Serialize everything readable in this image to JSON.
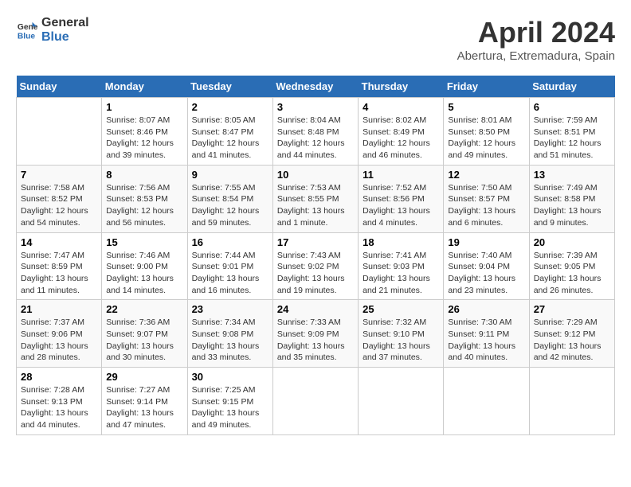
{
  "header": {
    "logo_general": "General",
    "logo_blue": "Blue",
    "month_title": "April 2024",
    "location": "Abertura, Extremadura, Spain"
  },
  "days_of_week": [
    "Sunday",
    "Monday",
    "Tuesday",
    "Wednesday",
    "Thursday",
    "Friday",
    "Saturday"
  ],
  "weeks": [
    [
      {
        "day": "",
        "sunrise": "",
        "sunset": "",
        "daylight": ""
      },
      {
        "day": "1",
        "sunrise": "Sunrise: 8:07 AM",
        "sunset": "Sunset: 8:46 PM",
        "daylight": "Daylight: 12 hours and 39 minutes."
      },
      {
        "day": "2",
        "sunrise": "Sunrise: 8:05 AM",
        "sunset": "Sunset: 8:47 PM",
        "daylight": "Daylight: 12 hours and 41 minutes."
      },
      {
        "day": "3",
        "sunrise": "Sunrise: 8:04 AM",
        "sunset": "Sunset: 8:48 PM",
        "daylight": "Daylight: 12 hours and 44 minutes."
      },
      {
        "day": "4",
        "sunrise": "Sunrise: 8:02 AM",
        "sunset": "Sunset: 8:49 PM",
        "daylight": "Daylight: 12 hours and 46 minutes."
      },
      {
        "day": "5",
        "sunrise": "Sunrise: 8:01 AM",
        "sunset": "Sunset: 8:50 PM",
        "daylight": "Daylight: 12 hours and 49 minutes."
      },
      {
        "day": "6",
        "sunrise": "Sunrise: 7:59 AM",
        "sunset": "Sunset: 8:51 PM",
        "daylight": "Daylight: 12 hours and 51 minutes."
      }
    ],
    [
      {
        "day": "7",
        "sunrise": "Sunrise: 7:58 AM",
        "sunset": "Sunset: 8:52 PM",
        "daylight": "Daylight: 12 hours and 54 minutes."
      },
      {
        "day": "8",
        "sunrise": "Sunrise: 7:56 AM",
        "sunset": "Sunset: 8:53 PM",
        "daylight": "Daylight: 12 hours and 56 minutes."
      },
      {
        "day": "9",
        "sunrise": "Sunrise: 7:55 AM",
        "sunset": "Sunset: 8:54 PM",
        "daylight": "Daylight: 12 hours and 59 minutes."
      },
      {
        "day": "10",
        "sunrise": "Sunrise: 7:53 AM",
        "sunset": "Sunset: 8:55 PM",
        "daylight": "Daylight: 13 hours and 1 minute."
      },
      {
        "day": "11",
        "sunrise": "Sunrise: 7:52 AM",
        "sunset": "Sunset: 8:56 PM",
        "daylight": "Daylight: 13 hours and 4 minutes."
      },
      {
        "day": "12",
        "sunrise": "Sunrise: 7:50 AM",
        "sunset": "Sunset: 8:57 PM",
        "daylight": "Daylight: 13 hours and 6 minutes."
      },
      {
        "day": "13",
        "sunrise": "Sunrise: 7:49 AM",
        "sunset": "Sunset: 8:58 PM",
        "daylight": "Daylight: 13 hours and 9 minutes."
      }
    ],
    [
      {
        "day": "14",
        "sunrise": "Sunrise: 7:47 AM",
        "sunset": "Sunset: 8:59 PM",
        "daylight": "Daylight: 13 hours and 11 minutes."
      },
      {
        "day": "15",
        "sunrise": "Sunrise: 7:46 AM",
        "sunset": "Sunset: 9:00 PM",
        "daylight": "Daylight: 13 hours and 14 minutes."
      },
      {
        "day": "16",
        "sunrise": "Sunrise: 7:44 AM",
        "sunset": "Sunset: 9:01 PM",
        "daylight": "Daylight: 13 hours and 16 minutes."
      },
      {
        "day": "17",
        "sunrise": "Sunrise: 7:43 AM",
        "sunset": "Sunset: 9:02 PM",
        "daylight": "Daylight: 13 hours and 19 minutes."
      },
      {
        "day": "18",
        "sunrise": "Sunrise: 7:41 AM",
        "sunset": "Sunset: 9:03 PM",
        "daylight": "Daylight: 13 hours and 21 minutes."
      },
      {
        "day": "19",
        "sunrise": "Sunrise: 7:40 AM",
        "sunset": "Sunset: 9:04 PM",
        "daylight": "Daylight: 13 hours and 23 minutes."
      },
      {
        "day": "20",
        "sunrise": "Sunrise: 7:39 AM",
        "sunset": "Sunset: 9:05 PM",
        "daylight": "Daylight: 13 hours and 26 minutes."
      }
    ],
    [
      {
        "day": "21",
        "sunrise": "Sunrise: 7:37 AM",
        "sunset": "Sunset: 9:06 PM",
        "daylight": "Daylight: 13 hours and 28 minutes."
      },
      {
        "day": "22",
        "sunrise": "Sunrise: 7:36 AM",
        "sunset": "Sunset: 9:07 PM",
        "daylight": "Daylight: 13 hours and 30 minutes."
      },
      {
        "day": "23",
        "sunrise": "Sunrise: 7:34 AM",
        "sunset": "Sunset: 9:08 PM",
        "daylight": "Daylight: 13 hours and 33 minutes."
      },
      {
        "day": "24",
        "sunrise": "Sunrise: 7:33 AM",
        "sunset": "Sunset: 9:09 PM",
        "daylight": "Daylight: 13 hours and 35 minutes."
      },
      {
        "day": "25",
        "sunrise": "Sunrise: 7:32 AM",
        "sunset": "Sunset: 9:10 PM",
        "daylight": "Daylight: 13 hours and 37 minutes."
      },
      {
        "day": "26",
        "sunrise": "Sunrise: 7:30 AM",
        "sunset": "Sunset: 9:11 PM",
        "daylight": "Daylight: 13 hours and 40 minutes."
      },
      {
        "day": "27",
        "sunrise": "Sunrise: 7:29 AM",
        "sunset": "Sunset: 9:12 PM",
        "daylight": "Daylight: 13 hours and 42 minutes."
      }
    ],
    [
      {
        "day": "28",
        "sunrise": "Sunrise: 7:28 AM",
        "sunset": "Sunset: 9:13 PM",
        "daylight": "Daylight: 13 hours and 44 minutes."
      },
      {
        "day": "29",
        "sunrise": "Sunrise: 7:27 AM",
        "sunset": "Sunset: 9:14 PM",
        "daylight": "Daylight: 13 hours and 47 minutes."
      },
      {
        "day": "30",
        "sunrise": "Sunrise: 7:25 AM",
        "sunset": "Sunset: 9:15 PM",
        "daylight": "Daylight: 13 hours and 49 minutes."
      },
      {
        "day": "",
        "sunrise": "",
        "sunset": "",
        "daylight": ""
      },
      {
        "day": "",
        "sunrise": "",
        "sunset": "",
        "daylight": ""
      },
      {
        "day": "",
        "sunrise": "",
        "sunset": "",
        "daylight": ""
      },
      {
        "day": "",
        "sunrise": "",
        "sunset": "",
        "daylight": ""
      }
    ]
  ]
}
